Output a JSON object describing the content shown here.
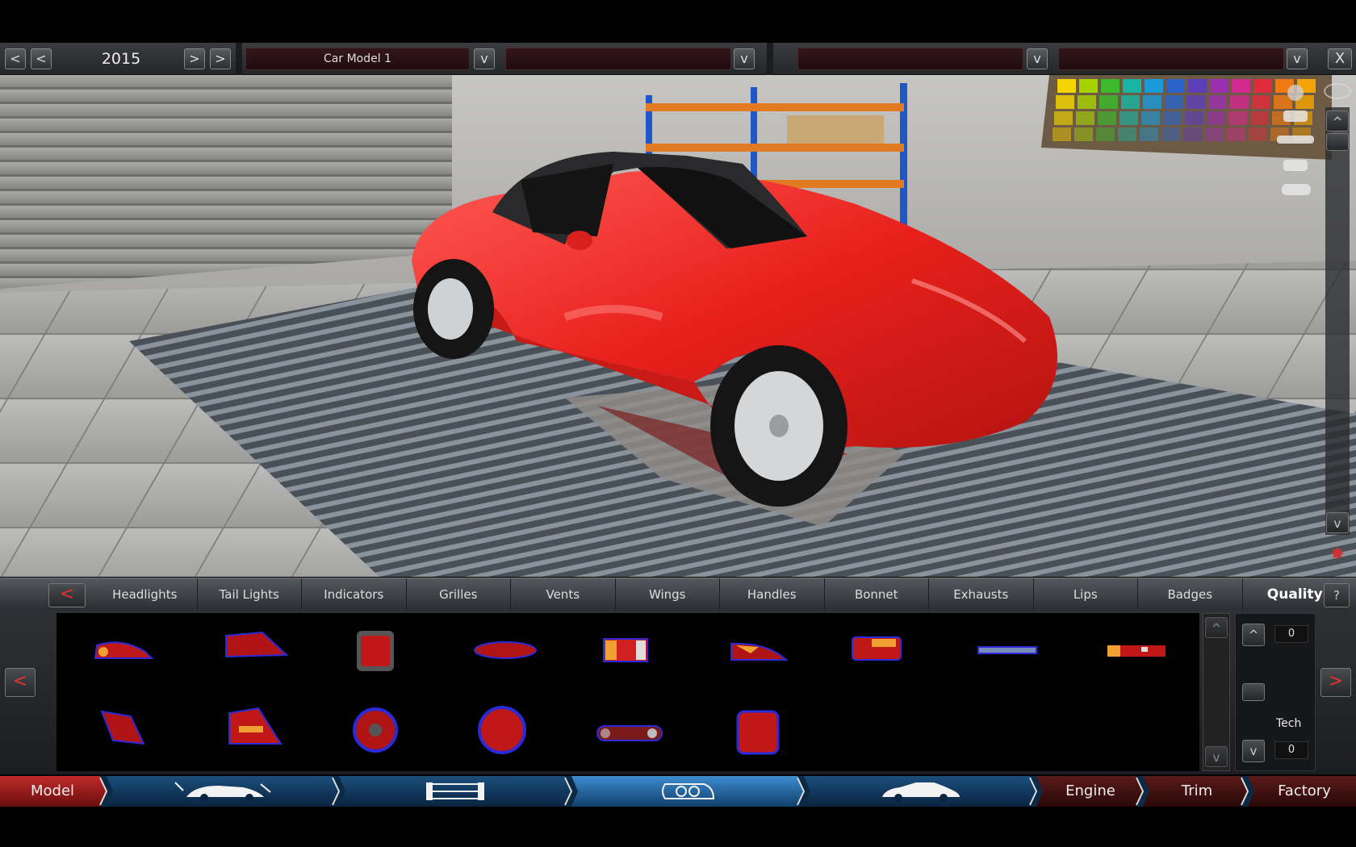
{
  "topbar": {
    "year_prev_far": "<",
    "year_prev": "<",
    "year": "2015",
    "year_next": ">",
    "year_next_far": ">",
    "model_dropdown": "Car Model 1",
    "dropdown_2": "",
    "dropdown_3": "",
    "dropdown_4": "",
    "dropdown_arrow": "v",
    "close": "X"
  },
  "viewport": {
    "scroll_up": "^",
    "scroll_down": "v",
    "palette_colors": [
      "#f4d400",
      "#a6d200",
      "#3bbb2b",
      "#18b5a4",
      "#1a9ad6",
      "#2b63c9",
      "#5d3eb8",
      "#9a2eb0",
      "#d22a8d",
      "#e02b3a",
      "#f07a12",
      "#f5a300"
    ]
  },
  "parts_tabs": {
    "back": "<",
    "items": [
      "Headlights",
      "Tail Lights",
      "Indicators",
      "Grilles",
      "Vents",
      "Wings",
      "Handles",
      "Bonnet",
      "Exhausts",
      "Lips",
      "Badges",
      "Quality"
    ],
    "help": "?"
  },
  "parts_panel": {
    "prev_page": "<",
    "next_page": ">",
    "list_up": "^",
    "list_down": "v",
    "tech_up": "^",
    "tech_down": "v",
    "top_value": "0",
    "tech_label": "Tech",
    "tech_value": "0"
  },
  "bottom_nav": {
    "model": "Model",
    "engine": "Engine",
    "trim": "Trim",
    "factory": "Factory",
    "icons": [
      "car-dimensions-icon",
      "chassis-icon",
      "headlight-icon",
      "car-body-icon"
    ]
  }
}
